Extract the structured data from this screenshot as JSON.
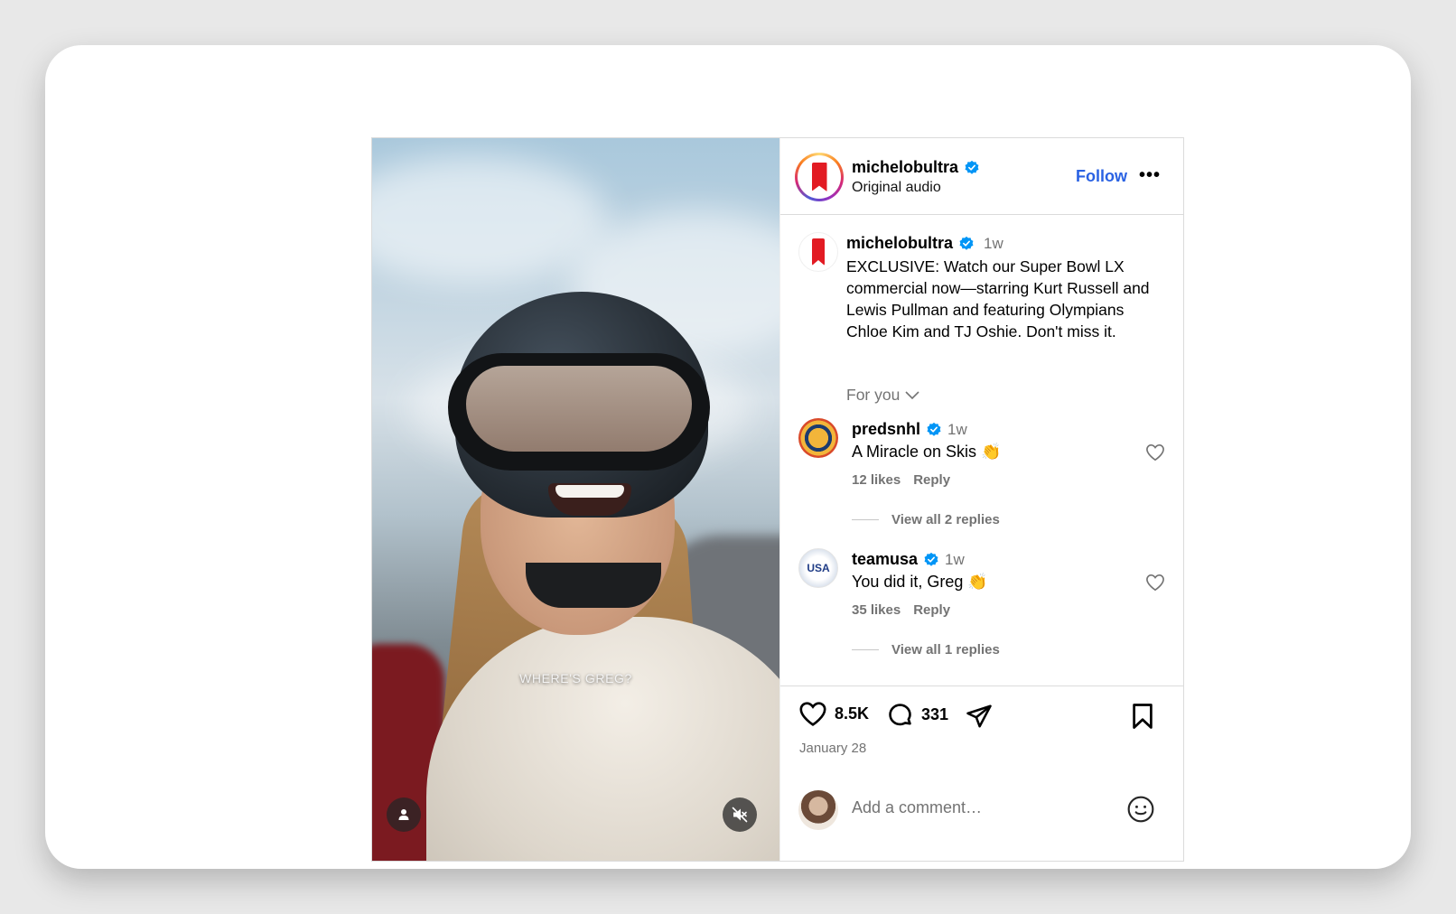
{
  "media": {
    "caption_overlay": "WHERE'S GREG?",
    "user_button_icon": "person-icon",
    "mute_button_icon": "speaker-muted-icon"
  },
  "header": {
    "username": "michelobultra",
    "subtitle": "Original audio",
    "follow_label": "Follow",
    "more_label": "•••"
  },
  "caption": {
    "username": "michelobultra",
    "age": "1w",
    "text": "EXCLUSIVE: Watch our Super Bowl LX commercial now—starring Kurt Russell and Lewis Pullman and featuring Olympians Chloe Kim and TJ Oshie. Don't miss it."
  },
  "sort": {
    "label": "For you"
  },
  "comments": [
    {
      "username": "predsnhl",
      "age": "1w",
      "text": "A Miracle on Skis 👏",
      "likes": "12 likes",
      "reply_label": "Reply",
      "replies_label": "View all 2 replies"
    },
    {
      "username": "teamusa",
      "age": "1w",
      "text": "You did it, Greg 👏",
      "likes": "35 likes",
      "reply_label": "Reply",
      "replies_label": "View all 1 replies",
      "avatar_text": "USA"
    }
  ],
  "actions": {
    "like_count": "8.5K",
    "comment_count": "331",
    "date": "January 28"
  },
  "add_comment": {
    "placeholder": "Add a comment…"
  },
  "colors": {
    "follow_blue": "#2a62e3",
    "verified_blue": "#0095f6",
    "brand_red": "#e21b23"
  }
}
